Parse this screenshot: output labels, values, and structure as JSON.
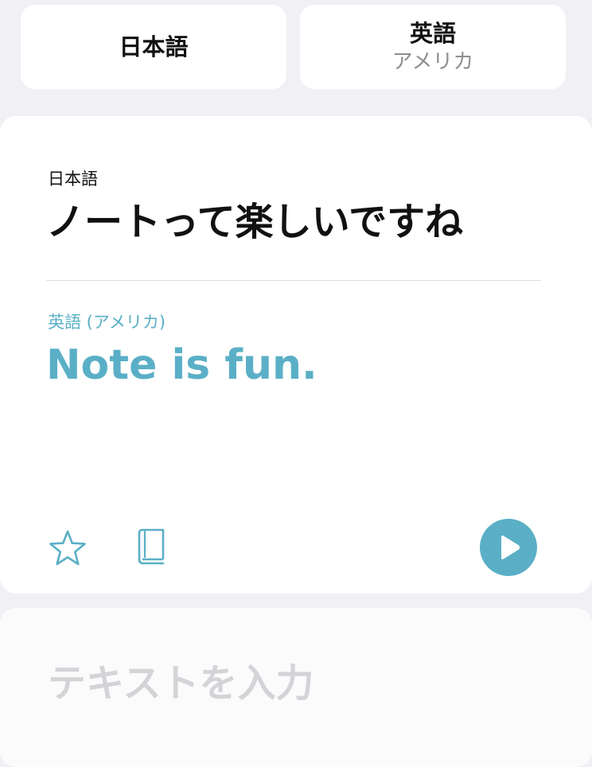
{
  "language_selector": {
    "source": {
      "main": "日本語"
    },
    "target": {
      "main": "英語",
      "sub": "アメリカ"
    }
  },
  "translation_card": {
    "source_label": "日本語",
    "source_text": "ノートって楽しいですね",
    "target_label": "英語 (アメリカ)",
    "target_text": "Note is fun.",
    "actions": {
      "favorite_icon": "star-icon",
      "dictionary_icon": "book-icon",
      "play_icon": "play-icon"
    }
  },
  "input": {
    "placeholder": "テキストを入力"
  },
  "colors": {
    "background": "#f0f0f5",
    "accent": "#5aafc6",
    "card": "#ffffff",
    "placeholder": "#d4d4d8",
    "secondary_text": "#8e8e93"
  }
}
